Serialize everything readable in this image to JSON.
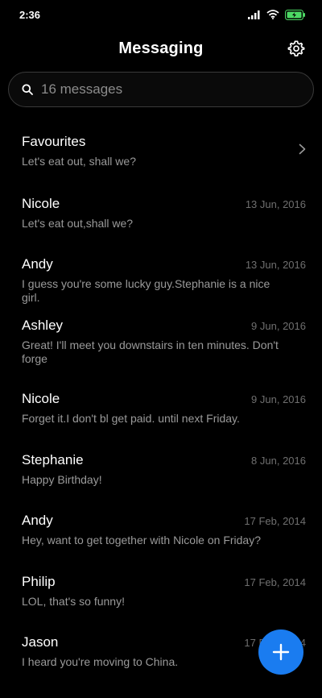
{
  "status_bar": {
    "time": "2:36"
  },
  "header": {
    "title": "Messaging"
  },
  "search": {
    "placeholder": "16 messages"
  },
  "favourites": {
    "name": "Favourites",
    "preview": "Let's eat out, shall we?"
  },
  "conversations": [
    {
      "name": "Nicole",
      "date": "13 Jun, 2016",
      "preview": "Let's eat out,shall we?"
    },
    {
      "name": "Andy",
      "date": "13 Jun, 2016",
      "preview": "I guess you're some lucky guy.Stephanie is a nice girl."
    },
    {
      "name": "Ashley",
      "date": "9 Jun, 2016",
      "preview": "Great! I'll meet you downstairs in ten minutes. Don't forge"
    },
    {
      "name": "Nicole",
      "date": "9 Jun, 2016",
      "preview": "Forget it.I don't bl get paid. until next Friday."
    },
    {
      "name": "Stephanie",
      "date": "8 Jun, 2016",
      "preview": "Happy Birthday!"
    },
    {
      "name": "Andy",
      "date": "17 Feb, 2014",
      "preview": "Hey, want to get together with Nicole on Friday?"
    },
    {
      "name": "Philip",
      "date": "17 Feb, 2014",
      "preview": "LOL, that's so funny!"
    },
    {
      "name": "Jason",
      "date": "17 Feb, 2014",
      "preview": "I heard you're moving to China."
    }
  ],
  "colors": {
    "accent": "#1a7cf0",
    "background": "#000000",
    "secondary_text": "#9a9a9a",
    "date_text": "#6f6f6f",
    "battery": "#4cd964"
  },
  "icons": {
    "settings": "gear-icon",
    "search": "search-icon",
    "chevron": "chevron-right-icon",
    "compose": "plus-icon"
  }
}
